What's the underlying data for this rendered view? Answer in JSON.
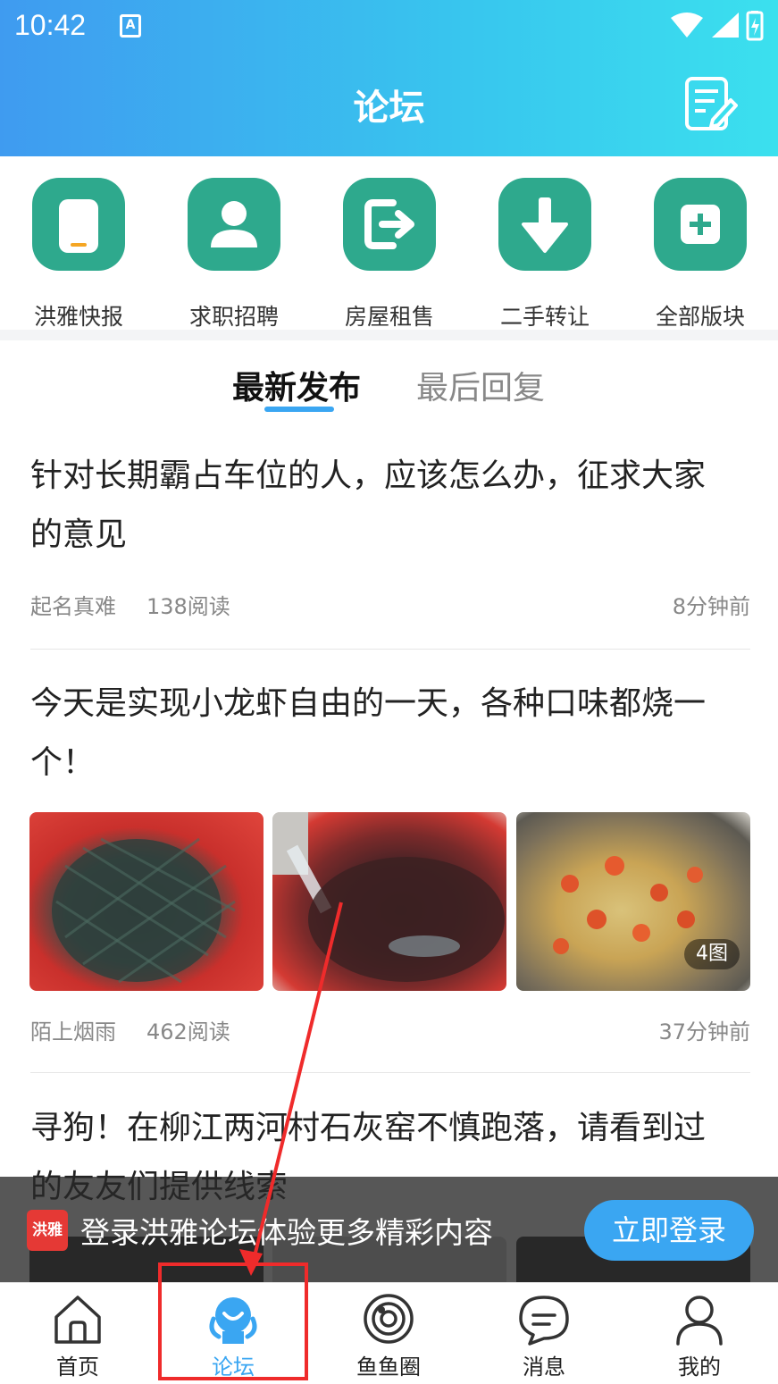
{
  "status_bar": {
    "time": "10:42",
    "ime_badge": "A"
  },
  "header": {
    "title": "论坛"
  },
  "quick_entries": [
    {
      "label": "洪雅快报",
      "icon": "phone-icon"
    },
    {
      "label": "求职招聘",
      "icon": "user-icon"
    },
    {
      "label": "房屋租售",
      "icon": "exit-door-icon"
    },
    {
      "label": "二手转让",
      "icon": "down-arrow-icon"
    },
    {
      "label": "全部版块",
      "icon": "plus-square-icon"
    }
  ],
  "tabs": {
    "active": "最新发布",
    "inactive": "最后回复"
  },
  "posts": [
    {
      "title": "针对长期霸占车位的人，应该怎么办，征求大家的意见",
      "author": "起名真难",
      "reads": "138阅读",
      "time": "8分钟前"
    },
    {
      "title": "今天是实现小龙虾自由的一天，各种口味都烧一个！",
      "author": "陌上烟雨",
      "reads": "462阅读",
      "time": "37分钟前",
      "image_count": "4图"
    },
    {
      "title": "寻狗！在柳江两河村石灰窑不慎跑落，请看到过的友友们提供线索"
    }
  ],
  "login_banner": {
    "logo_text": "洪雅",
    "text": "登录洪雅论坛体验更多精彩内容",
    "button": "立即登录"
  },
  "tabbar": [
    {
      "label": "首页",
      "icon": "home-icon"
    },
    {
      "label": "论坛",
      "icon": "forum-mascot-icon"
    },
    {
      "label": "鱼鱼圈",
      "icon": "planet-icon"
    },
    {
      "label": "消息",
      "icon": "chat-bubble-icon"
    },
    {
      "label": "我的",
      "icon": "profile-icon"
    }
  ],
  "colors": {
    "accent": "#3aa6f2",
    "quick_icon_bg": "#2ea98d",
    "annotation": "#ef2b2b"
  }
}
